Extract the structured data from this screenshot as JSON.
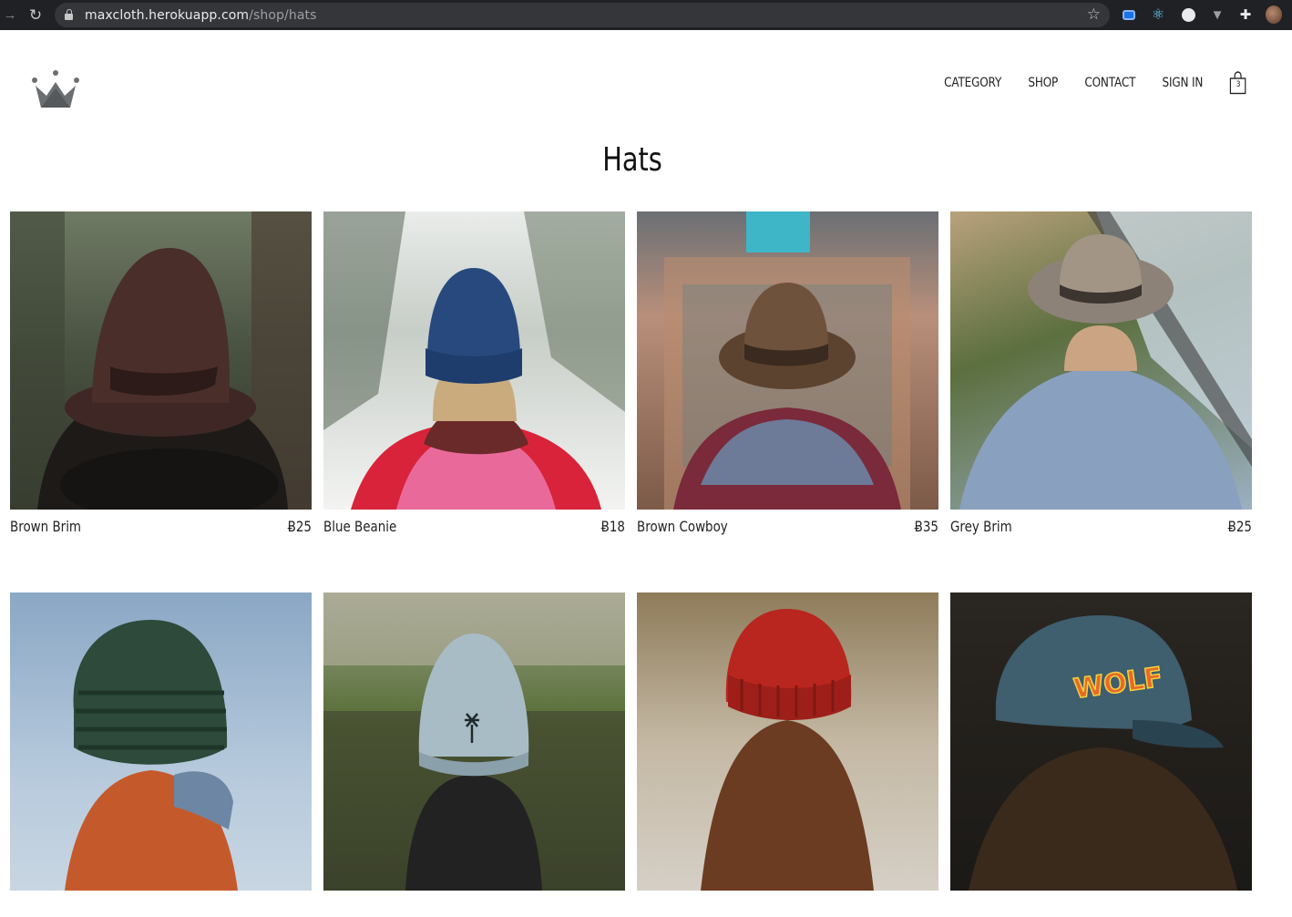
{
  "browser": {
    "url_host": "maxcloth.herokuapp.com",
    "url_path": "/shop/hats",
    "extensions": [
      "screen-capture-icon",
      "react-devtools-icon",
      "circle-extension-icon",
      "vue-devtools-icon",
      "puzzle-icon",
      "profile-avatar"
    ]
  },
  "header": {
    "logo": "crown-icon",
    "nav": {
      "category": "CATEGORY",
      "shop": "SHOP",
      "contact": "CONTACT",
      "sign_in": "SIGN IN"
    },
    "cart_count": "3"
  },
  "page": {
    "title": "Hats"
  },
  "products": [
    {
      "name": "Brown Brim",
      "price": "Ƀ25"
    },
    {
      "name": "Blue Beanie",
      "price": "Ƀ18"
    },
    {
      "name": "Brown Cowboy",
      "price": "Ƀ35"
    },
    {
      "name": "Grey Brim",
      "price": "Ƀ25"
    },
    {
      "name": "",
      "price": ""
    },
    {
      "name": "",
      "price": ""
    },
    {
      "name": "",
      "price": ""
    },
    {
      "name": "",
      "price": ""
    }
  ],
  "colors": {
    "chrome_bg": "#202124",
    "omnibox_bg": "#35363a",
    "text": "#222222",
    "logo_grey": "#6b6f72"
  }
}
